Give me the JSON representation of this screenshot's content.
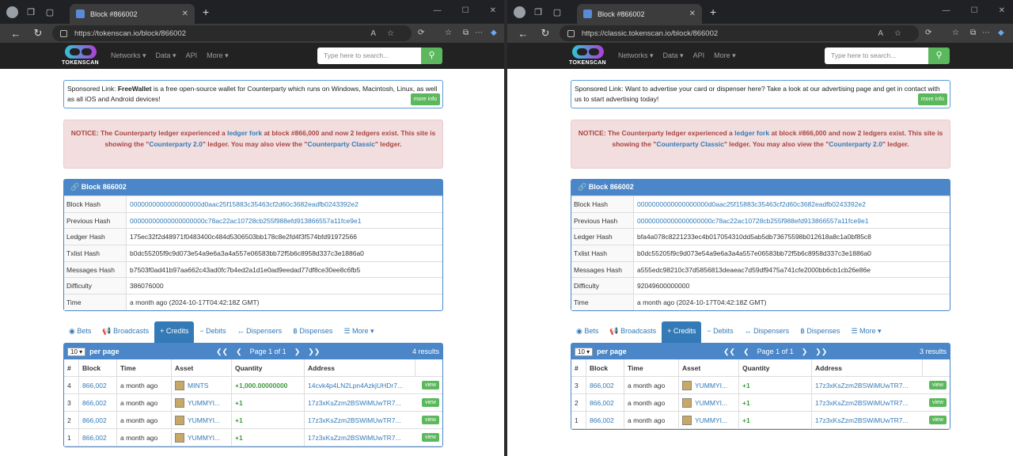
{
  "windows": [
    {
      "tab_title": "Block #866002",
      "url": "https://tokenscan.io/block/866002",
      "navbar": {
        "brand": "TOKENSCAN",
        "menu": [
          "Networks ▾",
          "Data ▾",
          "API",
          "More ▾"
        ],
        "search_placeholder": "Type here to search..."
      },
      "sponsor": {
        "prefix": "Sponsored Link:",
        "name": "FreeWallet",
        "text": " is a free open-source wallet for Counterparty which runs on Windows, Macintosh, Linux, as well as all iOS and Android devices!",
        "more": "more info"
      },
      "notice": {
        "p1": "NOTICE: The Counterparty ledger experienced a ",
        "l1": "ledger fork",
        "p2": " at block #866,000 and now 2 ledgers exist. This site is showing the \"",
        "l2": "Counterparty 2.0",
        "p3": "\" ledger. You may also view the \"",
        "l3": "Counterparty Classic",
        "p4": "\" ledger."
      },
      "block": {
        "title": "Block 866002",
        "rows": [
          {
            "k": "Block Hash",
            "v": "0000000000000000000d0aac25f15883c35463cf2d60c3682eadfb0243392e2"
          },
          {
            "k": "Previous Hash",
            "v": "00000000000000000000c78ac22ac10728cb255f988efd913866557a11fce9e1"
          },
          {
            "k": "Ledger Hash",
            "v": "175ec32f2d48971f0483400c484d5306503bb178c8e2fd4f3f574bfd91972566"
          },
          {
            "k": "Txlist Hash",
            "v": "b0dc55205f9c9d073e54a9e6a3a4a557e06583bb72f5b6c8958d337c3e1886a0"
          },
          {
            "k": "Messages Hash",
            "v": "b7503f0ad41b97aa662c43ad0fc7b4ed2a1d1e0ad9eedad77df8ce30ee8c6fb5"
          },
          {
            "k": "Difficulty",
            "v": "386076000"
          },
          {
            "k": "Time",
            "v": "a month ago (2024-10-17T04:42:18Z GMT)"
          }
        ]
      },
      "tabs": [
        "◉ Bets",
        "📢 Broadcasts",
        "+ Credits",
        "− Debits",
        "↔ Dispensers",
        "฿ Dispenses",
        "☰ More ▾"
      ],
      "table": {
        "per": "10",
        "per_label": "per page",
        "page": "Page 1 of 1",
        "results": "4 results",
        "cols": [
          "#",
          "Block",
          "Time",
          "Asset",
          "Quantity",
          "Address"
        ],
        "rows": [
          {
            "n": "4",
            "block": "866,002",
            "time": "a month ago",
            "asset": "MINTS",
            "qty": "+1,000.00000000",
            "addr": "14cvk4p4LN2Lpn4AzkjUHDr7..."
          },
          {
            "n": "3",
            "block": "866,002",
            "time": "a month ago",
            "asset": "YUMMYI...",
            "qty": "+1",
            "addr": "17z3xKsZzm2BSWiMUwTR7..."
          },
          {
            "n": "2",
            "block": "866,002",
            "time": "a month ago",
            "asset": "YUMMYI...",
            "qty": "+1",
            "addr": "17z3xKsZzm2BSWiMUwTR7..."
          },
          {
            "n": "1",
            "block": "866,002",
            "time": "a month ago",
            "asset": "YUMMYI...",
            "qty": "+1",
            "addr": "17z3xKsZzm2BSWiMUwTR7..."
          }
        ],
        "view": "view"
      }
    },
    {
      "tab_title": "Block #866002",
      "url": "https://classic.tokenscan.io/block/866002",
      "navbar": {
        "brand": "TOKENSCAN",
        "menu": [
          "Networks ▾",
          "Data ▾",
          "API",
          "More ▾"
        ],
        "search_placeholder": "Type here to search..."
      },
      "sponsor": {
        "prefix": "Sponsored Link:",
        "name": "",
        "text": " Want to advertise your card or dispenser here? Take a look at our advertising page and get in contact with us to start advertising today!",
        "more": "more info"
      },
      "notice": {
        "p1": "NOTICE: The Counterparty ledger experienced a ",
        "l1": "ledger fork",
        "p2": " at block #866,000 and now 2 ledgers exist. This site is showing the \"",
        "l2": "Counterparty Classic",
        "p3": "\" ledger. You may also view the \"",
        "l3": "Counterparty 2.0",
        "p4": "\" ledger."
      },
      "block": {
        "title": "Block 866002",
        "rows": [
          {
            "k": "Block Hash",
            "v": "0000000000000000000d0aac25f15883c35463cf2d60c3682eadfb0243392e2"
          },
          {
            "k": "Previous Hash",
            "v": "00000000000000000000c78ac22ac10728cb255f988efd913866557a11fce9e1"
          },
          {
            "k": "Ledger Hash",
            "v": "bfa4a078c8221233ec4b017054310dd5ab5db73675598b012618a8c1a0bf85c8"
          },
          {
            "k": "Txlist Hash",
            "v": "b0dc55205f9c9d073e54a9e6a3a4a557e06583bb72f5b6c8958d337c3e1886a0"
          },
          {
            "k": "Messages Hash",
            "v": "a555edc98210c37d5856813deaeac7d59df9475a741cfe2000bb6cb1cb26e86e"
          },
          {
            "k": "Difficulty",
            "v": "92049600000000"
          },
          {
            "k": "Time",
            "v": "a month ago (2024-10-17T04:42:18Z GMT)"
          }
        ]
      },
      "tabs": [
        "◉ Bets",
        "📢 Broadcasts",
        "+ Credits",
        "− Debits",
        "↔ Dispensers",
        "฿ Dispenses",
        "☰ More ▾"
      ],
      "table": {
        "per": "10",
        "per_label": "per page",
        "page": "Page 1 of 1",
        "results": "3 results",
        "cols": [
          "#",
          "Block",
          "Time",
          "Asset",
          "Quantity",
          "Address"
        ],
        "rows": [
          {
            "n": "3",
            "block": "866,002",
            "time": "a month ago",
            "asset": "YUMMYI...",
            "qty": "+1",
            "addr": "17z3xKsZzm2BSWiMUwTR7..."
          },
          {
            "n": "2",
            "block": "866,002",
            "time": "a month ago",
            "asset": "YUMMYI...",
            "qty": "+1",
            "addr": "17z3xKsZzm2BSWiMUwTR7..."
          },
          {
            "n": "1",
            "block": "866,002",
            "time": "a month ago",
            "asset": "YUMMYI...",
            "qty": "+1",
            "addr": "17z3xKsZzm2BSWiMUwTR7..."
          }
        ],
        "view": "view"
      }
    }
  ]
}
